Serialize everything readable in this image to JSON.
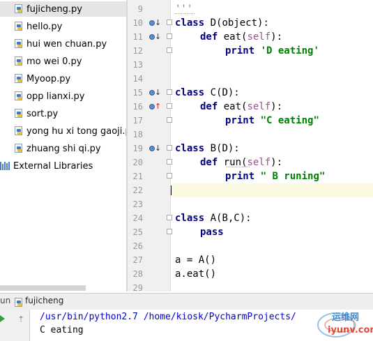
{
  "project": {
    "files": [
      "fujicheng.py",
      "hello.py",
      "hui wen chuan.py",
      "mo wei 0.py",
      "Myoop.py",
      "opp lianxi.py",
      "sort.py",
      "yong hu xi tong gaoji.py",
      "zhuang shi qi.py"
    ],
    "selected": "fujicheng.py",
    "external": "External Libraries"
  },
  "editor": {
    "line_numbers": [
      "9",
      "10",
      "11",
      "12",
      "13",
      "14",
      "15",
      "16",
      "17",
      "18",
      "19",
      "20",
      "21",
      "22",
      "23",
      "24",
      "25",
      "26",
      "27",
      "28",
      "29"
    ],
    "lines": {
      "l9": "'''",
      "l10_kw": "class",
      "l10_rest": " D(object):",
      "l11_kw": "def",
      "l11_a": " eat(",
      "l11_self": "self",
      "l11_b": "):",
      "l12_kw": "print",
      "l12_str": "'D eating'",
      "l15_kw": "class",
      "l15_rest": " C(D):",
      "l16_kw": "def",
      "l16_a": " eat(",
      "l16_self": "self",
      "l16_b": "):",
      "l17_kw": "print",
      "l17_str": "\"C eating\"",
      "l19_kw": "class",
      "l19_rest": " B(D):",
      "l20_kw": "def",
      "l20_a": " run(",
      "l20_self": "self",
      "l20_b": "):",
      "l21_kw": "print",
      "l21_str": "\" B runing\"",
      "l24_kw": "class",
      "l24_rest": " A(B,C):",
      "l25_kw": "pass",
      "l27": "a = A()",
      "l28": "a.eat()"
    },
    "current_line": "22"
  },
  "run": {
    "label": "un",
    "title": "fujicheng",
    "console_cmd": "/usr/bin/python2.7 /home/kiosk/PycharmProjects/",
    "console_out": "C eating"
  },
  "watermark": {
    "cn": "运维网",
    "url": "iyunv.com"
  },
  "colors": {
    "keyword": "#000080",
    "string": "#008000",
    "self": "#94558d",
    "console_cmd": "#0000cc"
  }
}
